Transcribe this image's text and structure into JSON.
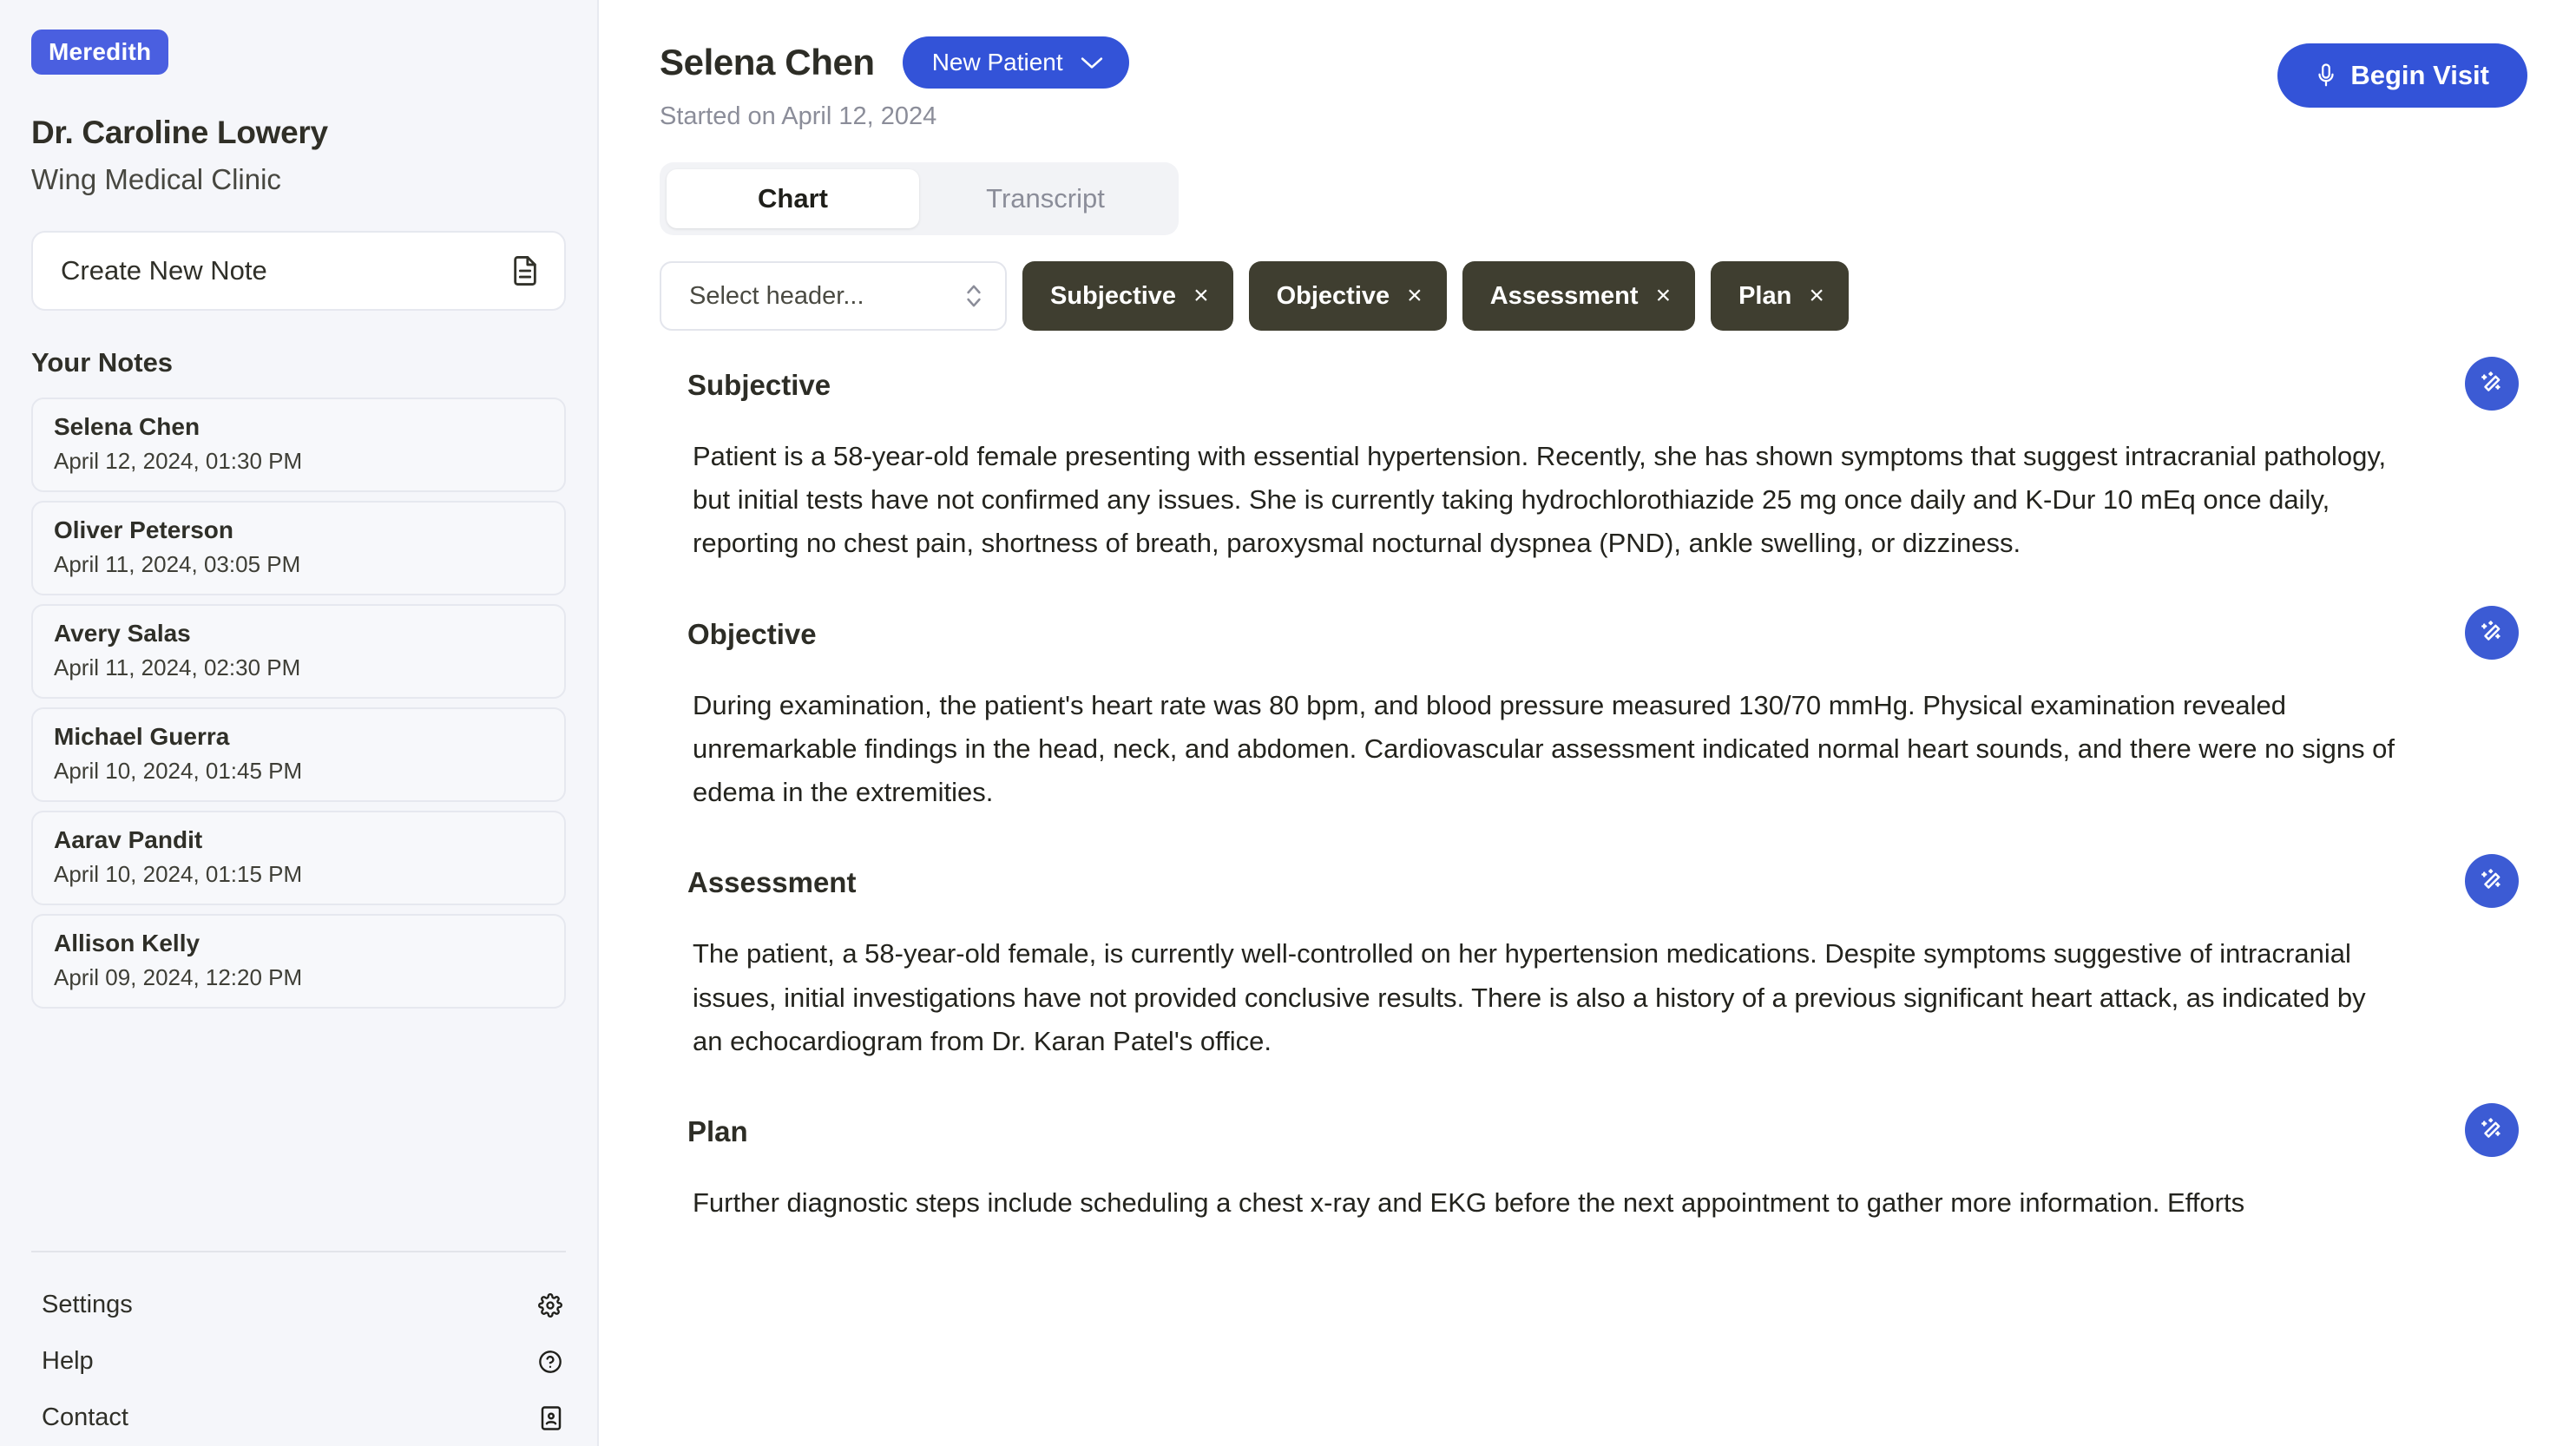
{
  "sidebar": {
    "brand": "Meredith",
    "doctor_name": "Dr. Caroline Lowery",
    "clinic_name": "Wing Medical Clinic",
    "create_note_label": "Create New Note",
    "notes_section_title": "Your Notes",
    "notes": [
      {
        "name": "Selena Chen",
        "date": "April 12, 2024, 01:30 PM"
      },
      {
        "name": "Oliver Peterson",
        "date": "April 11, 2024, 03:05 PM"
      },
      {
        "name": "Avery Salas",
        "date": "April 11, 2024, 02:30 PM"
      },
      {
        "name": "Michael Guerra",
        "date": "April 10, 2024, 01:45 PM"
      },
      {
        "name": "Aarav Pandit",
        "date": "April 10, 2024, 01:15 PM"
      },
      {
        "name": "Allison Kelly",
        "date": "April 09, 2024, 12:20 PM"
      }
    ],
    "footer": [
      {
        "label": "Settings",
        "icon": "gear-icon"
      },
      {
        "label": "Help",
        "icon": "question-circle-icon"
      },
      {
        "label": "Contact",
        "icon": "contact-card-icon"
      }
    ]
  },
  "header": {
    "patient_name": "Selena Chen",
    "status_label": "New Patient",
    "started_on": "Started on April 12, 2024",
    "begin_visit_label": "Begin Visit",
    "begin_visit_icon": "microphone-icon"
  },
  "tabs": [
    {
      "label": "Chart",
      "active": true
    },
    {
      "label": "Transcript",
      "active": false
    }
  ],
  "header_controls": {
    "select_placeholder": "Select header...",
    "chips": [
      "Subjective",
      "Objective",
      "Assessment",
      "Plan"
    ],
    "chip_remove_glyph": "×"
  },
  "sections": [
    {
      "title": "Subjective",
      "body": "Patient is a 58-year-old female presenting with essential hypertension. Recently, she has shown symptoms that suggest intracranial pathology, but initial tests have not confirmed any issues. She is currently taking hydrochlorothiazide 25 mg once daily and K-Dur 10 mEq once daily, reporting no chest pain, shortness of breath, paroxysmal nocturnal dyspnea (PND), ankle swelling, or dizziness."
    },
    {
      "title": "Objective",
      "body": "During examination, the patient's heart rate was 80 bpm, and blood pressure measured 130/70 mmHg. Physical examination revealed unremarkable findings in the head, neck, and abdomen. Cardiovascular assessment indicated normal heart sounds, and there were no signs of edema in the extremities."
    },
    {
      "title": "Assessment",
      "body": "The patient, a 58-year-old female, is currently well-controlled on her hypertension medications. Despite symptoms suggestive of intracranial issues, initial investigations have not provided conclusive results. There is also a history of a previous significant heart attack, as indicated by an echocardiogram from Dr. Karan Patel's office."
    },
    {
      "title": "Plan",
      "body": "Further diagnostic steps include scheduling a chest x-ray and EKG before the next appointment to gather more information. Efforts"
    }
  ],
  "colors": {
    "brand_badge": "#4a5fe0",
    "primary_blue": "#3353d8",
    "chip_dark": "#3f3e30",
    "sidebar_bg": "#f5f6fa",
    "muted_text": "#8b8d99"
  }
}
